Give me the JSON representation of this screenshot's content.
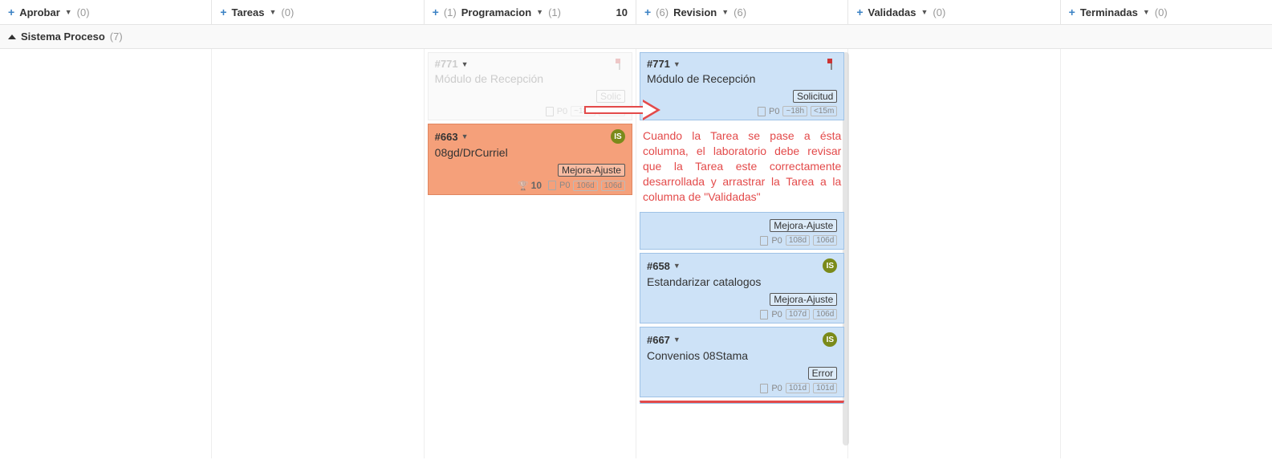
{
  "columns": [
    {
      "name": "Aprobar",
      "pre": "",
      "count": "(0)",
      "score": ""
    },
    {
      "name": "Tareas",
      "pre": "",
      "count": "(0)",
      "score": ""
    },
    {
      "name": "Programacion",
      "pre": "(1)",
      "count": "(1)",
      "score": "10"
    },
    {
      "name": "Revision",
      "pre": "(6)",
      "count": "(6)",
      "score": ""
    },
    {
      "name": "Validadas",
      "pre": "",
      "count": "(0)",
      "score": ""
    },
    {
      "name": "Terminadas",
      "pre": "",
      "count": "(0)",
      "score": ""
    }
  ],
  "swimlane": {
    "title": "Sistema Proceso",
    "count": "(7)"
  },
  "ghost_card": {
    "id": "#771",
    "title": "Módulo de Recepción",
    "tag": "Solic",
    "priority": "P0",
    "time1": "~18h",
    "time2": "<15m"
  },
  "card663": {
    "id": "#663",
    "title": "08gd/DrCurriel",
    "avatar": "IS",
    "tag": "Mejora-Ajuste",
    "score": "10",
    "priority": "P0",
    "time1": "106d",
    "time2": "106d"
  },
  "card771": {
    "id": "#771",
    "title": "Módulo de Recepción",
    "tag": "Solicitud",
    "priority": "P0",
    "time1": "~18h",
    "time2": "<15m"
  },
  "red_note": "Cuando la Tarea se pase a ésta columna, el laboratorio debe revisar que la Tarea este correctamente desarrollada y arrastrar la Tarea a la columna de \"Validadas\"",
  "card_frag": {
    "tag": "Mejora-Ajuste",
    "priority": "P0",
    "time1": "108d",
    "time2": "106d"
  },
  "card658": {
    "id": "#658",
    "title": "Estandarizar catalogos",
    "avatar": "IS",
    "tag": "Mejora-Ajuste",
    "priority": "P0",
    "time1": "107d",
    "time2": "106d"
  },
  "card667": {
    "id": "#667",
    "title": "Convenios 08Stama",
    "avatar": "IS",
    "tag": "Error",
    "priority": "P0",
    "time1": "101d",
    "time2": "101d"
  }
}
